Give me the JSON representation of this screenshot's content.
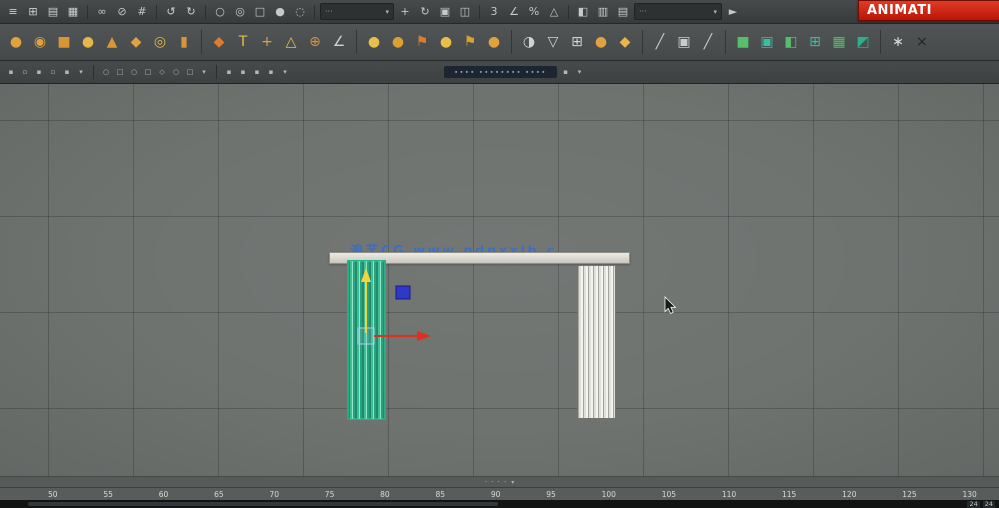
{
  "overlay": {
    "animation_label": "ANIMATI"
  },
  "topbar": {
    "file_icons": [
      {
        "name": "menu-icon",
        "glyph": "≡",
        "color": "#cdd1d0"
      },
      {
        "name": "new-scene-icon",
        "glyph": "⊞",
        "color": "#cdd1d0"
      },
      {
        "name": "open-file-icon",
        "glyph": "▤",
        "color": "#cdd1d0"
      },
      {
        "name": "save-file-icon",
        "glyph": "▦",
        "color": "#cdd1d0"
      }
    ],
    "link_icons": [
      {
        "name": "link-icon",
        "glyph": "∞",
        "color": "#c2c6c5"
      },
      {
        "name": "unlink-icon",
        "glyph": "⊘",
        "color": "#c2c6c5"
      },
      {
        "name": "bind-icon",
        "glyph": "#",
        "color": "#c2c6c5"
      }
    ],
    "undo_icons": [
      {
        "name": "undo-icon",
        "glyph": "↺",
        "color": "#cdd1d0"
      },
      {
        "name": "redo-icon",
        "glyph": "↻",
        "color": "#cdd1d0"
      }
    ],
    "select_icons": [
      {
        "name": "select-object-icon",
        "glyph": "○",
        "color": "#c6cac9"
      },
      {
        "name": "select-by-name-icon",
        "glyph": "◎",
        "color": "#c6cac9"
      },
      {
        "name": "select-region-icon",
        "glyph": "□",
        "color": "#c6cac9"
      },
      {
        "name": "select-circle-icon",
        "glyph": "●",
        "color": "#c6cac9"
      },
      {
        "name": "lasso-select-icon",
        "glyph": "◌",
        "color": "#c6cac9"
      }
    ],
    "filter_combo_value": "···",
    "transform_icons": [
      {
        "name": "move-tool-icon",
        "glyph": "+",
        "color": "#c6cac9"
      },
      {
        "name": "rotate-tool-icon",
        "glyph": "↻",
        "color": "#c6cac9"
      },
      {
        "name": "scale-tool-icon",
        "glyph": "▣",
        "color": "#c6cac9"
      },
      {
        "name": "mirror-tool-icon",
        "glyph": "◫",
        "color": "#c6cac9"
      }
    ],
    "snap_icons": [
      {
        "name": "snap-3d-icon",
        "glyph": "3",
        "color": "#c6cac9"
      },
      {
        "name": "angle-snap-icon",
        "glyph": "∠",
        "color": "#c6cac9"
      },
      {
        "name": "percent-snap-icon",
        "glyph": "%",
        "color": "#c6cac9"
      },
      {
        "name": "spinner-snap-icon",
        "glyph": "△",
        "color": "#c6cac9"
      }
    ],
    "sets_combo_value": "···",
    "more_icons": [
      {
        "name": "mirror-icon",
        "glyph": "◧",
        "color": "#c6cac9"
      },
      {
        "name": "align-icon",
        "glyph": "▥",
        "color": "#c6cac9"
      },
      {
        "name": "layer-manager-icon",
        "glyph": "▤",
        "color": "#c6cac9"
      }
    ],
    "overflow_arrow": "►"
  },
  "shelf": {
    "g1": [
      {
        "name": "sphere-tool-icon",
        "glyph": "●",
        "color": "#e0a23c"
      },
      {
        "name": "geosphere-tool-icon",
        "glyph": "◉",
        "color": "#e0a23c"
      },
      {
        "name": "box-tool-icon",
        "glyph": "■",
        "color": "#d99534"
      },
      {
        "name": "sphere2-tool-icon",
        "glyph": "●",
        "color": "#e6b84a"
      },
      {
        "name": "cone-tool-icon",
        "glyph": "▲",
        "color": "#d99534"
      },
      {
        "name": "diamond-tool-icon",
        "glyph": "◆",
        "color": "#e0a23c"
      },
      {
        "name": "torus-tool-icon",
        "glyph": "◎",
        "color": "#e6b84a"
      },
      {
        "name": "cylinder-tool-icon",
        "glyph": "▮",
        "color": "#d99534"
      }
    ],
    "g2": [
      {
        "name": "shape-tool-icon",
        "glyph": "◆",
        "color": "#e07b2a"
      },
      {
        "name": "text-tool-icon",
        "glyph": "T",
        "color": "#e6c04a"
      },
      {
        "name": "add-tool-icon",
        "glyph": "+",
        "color": "#e0a23c"
      },
      {
        "name": "triangle-tool-icon",
        "glyph": "△",
        "color": "#e6c04a"
      },
      {
        "name": "boolean-tool-icon",
        "glyph": "⊕",
        "color": "#d99534"
      },
      {
        "name": "angle-tool-icon",
        "glyph": "∠",
        "color": "#cfd3d2"
      }
    ],
    "g3": [
      {
        "name": "coin-tool-icon",
        "glyph": "●",
        "color": "#e6c04a"
      },
      {
        "name": "coin2-tool-icon",
        "glyph": "●",
        "color": "#d9a032"
      },
      {
        "name": "flag-tool-icon",
        "glyph": "⚑",
        "color": "#e07b2a"
      },
      {
        "name": "coin3-tool-icon",
        "glyph": "●",
        "color": "#e6c04a"
      },
      {
        "name": "flag2-tool-icon",
        "glyph": "⚑",
        "color": "#d9a032"
      },
      {
        "name": "coin4-tool-icon",
        "glyph": "●",
        "color": "#e0a23c"
      }
    ],
    "g4": [
      {
        "name": "half-circle-tool-icon",
        "glyph": "◑",
        "color": "#cfd3d2"
      },
      {
        "name": "down-triangle-tool-icon",
        "glyph": "▽",
        "color": "#cfd3d2"
      },
      {
        "name": "grid-tool-icon",
        "glyph": "⊞",
        "color": "#cfd3d2"
      },
      {
        "name": "gold-sphere-tool-icon",
        "glyph": "●",
        "color": "#e0a23c"
      },
      {
        "name": "gold-diamond-tool-icon",
        "glyph": "◆",
        "color": "#e6b84a"
      }
    ],
    "g5": [
      {
        "name": "line-tool-icon",
        "glyph": "╱",
        "color": "#c8cccb"
      },
      {
        "name": "plane-tool-icon",
        "glyph": "▣",
        "color": "#c8cccb"
      },
      {
        "name": "curve-tool-icon",
        "glyph": "╱",
        "color": "#c8cccb"
      }
    ],
    "g6": [
      {
        "name": "poly-cube-icon",
        "glyph": "■",
        "color": "#57bf6a"
      },
      {
        "name": "poly-plane-icon",
        "glyph": "▣",
        "color": "#35c0a8"
      },
      {
        "name": "poly-half-icon",
        "glyph": "◧",
        "color": "#57bf6a"
      },
      {
        "name": "poly-grid-icon",
        "glyph": "⊞",
        "color": "#35c0a8"
      },
      {
        "name": "poly-mesh-icon",
        "glyph": "▦",
        "color": "#57bf6a"
      },
      {
        "name": "poly-corner-icon",
        "glyph": "◩",
        "color": "#2fae8f"
      }
    ],
    "g7": [
      {
        "name": "burst-tool-icon",
        "glyph": "∗",
        "color": "#d8dcda"
      },
      {
        "name": "close-tool-icon",
        "glyph": "×",
        "color": "#202424"
      }
    ]
  },
  "statusbar": {
    "icons_a": [
      {
        "name": "mini-toggle-icon",
        "glyph": "▪"
      },
      {
        "name": "mini-toggle2-icon",
        "glyph": "▫"
      },
      {
        "name": "mini-toggle3-icon",
        "glyph": "▪"
      },
      {
        "name": "mini-toggle4-icon",
        "glyph": "▫"
      },
      {
        "name": "mini-toggle5-icon",
        "glyph": "▪"
      },
      {
        "name": "mini-dropdown-icon",
        "glyph": "▾"
      }
    ],
    "icons_b": [
      {
        "name": "mini-circle-icon",
        "glyph": "○"
      },
      {
        "name": "mini-square-icon",
        "glyph": "□"
      },
      {
        "name": "mini-circle2-icon",
        "glyph": "○"
      },
      {
        "name": "mini-square2-icon",
        "glyph": "□"
      },
      {
        "name": "mini-diamond-icon",
        "glyph": "◇"
      },
      {
        "name": "mini-circle3-icon",
        "glyph": "○"
      },
      {
        "name": "mini-square3-icon",
        "glyph": "□"
      },
      {
        "name": "mini-dropdown2-icon",
        "glyph": "▾"
      }
    ],
    "icons_c": [
      {
        "name": "mini-block-icon",
        "glyph": "▪"
      },
      {
        "name": "mini-block2-icon",
        "glyph": "▪"
      },
      {
        "name": "mini-block3-icon",
        "glyph": "▪"
      },
      {
        "name": "mini-block4-icon",
        "glyph": "▪"
      },
      {
        "name": "mini-dropdown3-icon",
        "glyph": "▾"
      }
    ],
    "label": "∙∙∙∙ ∙∙∙∙∙∙∙∙ ∙∙∙∙",
    "icons_d": [
      {
        "name": "mini-block5-icon",
        "glyph": "▪"
      },
      {
        "name": "mini-dropdown4-icon",
        "glyph": "▾"
      }
    ]
  },
  "viewport": {
    "watermark": "浪艺CG www.qdnxxlb.c",
    "footer_label": "· · · ·"
  },
  "timeline": {
    "ticks": [
      "50",
      "55",
      "60",
      "65",
      "70",
      "75",
      "80",
      "85",
      "90",
      "95",
      "100",
      "105",
      "110",
      "115",
      "120",
      "125",
      "130"
    ],
    "end_fields": [
      "24",
      "24"
    ]
  }
}
